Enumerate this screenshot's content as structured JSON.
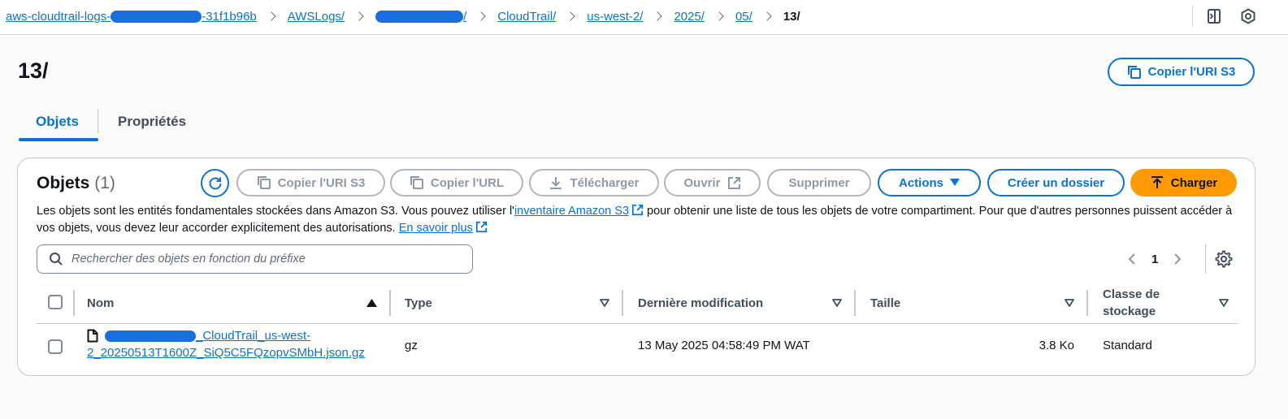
{
  "breadcrumb": {
    "items": [
      {
        "pre": "aws-cloudtrail-logs-",
        "post": "-31f1b96b",
        "redacted": true
      },
      {
        "label": "AWSLogs/"
      },
      {
        "post": "/",
        "redacted": true
      },
      {
        "label": "CloudTrail/"
      },
      {
        "label": "us-west-2/"
      },
      {
        "label": "2025/"
      },
      {
        "label": "05/"
      }
    ],
    "current": "13/"
  },
  "topbar_icons": [
    "panel-toggle-icon",
    "help-settings-icon"
  ],
  "page": {
    "title": "13/",
    "copy_uri_button": "Copier l'URI S3"
  },
  "tabs": [
    {
      "label": "Objets",
      "active": true
    },
    {
      "label": "Propriétés",
      "active": false
    }
  ],
  "objects_panel": {
    "title": "Objets",
    "count": "(1)",
    "buttons": {
      "copy_uri": "Copier l'URI S3",
      "copy_url": "Copier l'URL",
      "download": "Télécharger",
      "open": "Ouvrir",
      "delete": "Supprimer",
      "actions": "Actions",
      "create_folder": "Créer un dossier",
      "upload": "Charger"
    },
    "description": {
      "part1": "Les objets sont les entités fondamentales stockées dans Amazon S3. Vous pouvez utiliser l'",
      "link1": "inventaire Amazon S3",
      "part2": " pour obtenir une liste de tous les objets de votre compartiment. Pour que d'autres personnes puissent accéder à vos objets, vous devez leur accorder explicitement des autorisations. ",
      "link2": "En savoir plus"
    },
    "search_placeholder": "Rechercher des objets en fonction du préfixe",
    "pagination": {
      "current_page": "1"
    }
  },
  "table": {
    "columns": [
      "Nom",
      "Type",
      "Dernière modification",
      "Taille",
      "Classe de stockage"
    ],
    "rows": [
      {
        "name_line1_suffix": "_CloudTrail_us-west-",
        "name_line2": "2_20250513T1600Z_SiQ5C5FQzopvSMbH.json.gz",
        "type": "gz",
        "last_modified": "13 May 2025 04:58:49 PM WAT",
        "size": "3.8 Ko",
        "storage_class": "Standard"
      }
    ]
  },
  "colors": {
    "link": "#0972d3",
    "primary_button": "#ff9900",
    "redaction": "#1a6fe0"
  }
}
